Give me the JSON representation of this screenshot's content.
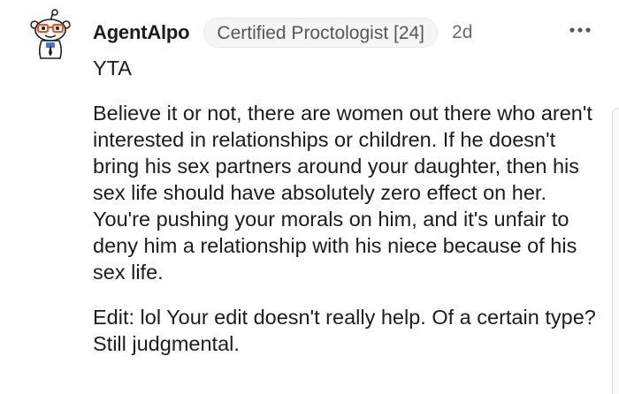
{
  "comment": {
    "author": "AgentAlpo",
    "flair": "Certified Proctologist [24]",
    "age": "2d",
    "verdict": "YTA",
    "paragraphs": [
      "Believe it or not, there are women out there who aren't interested in relationships or children. If he doesn't bring his sex partners around your daughter, then his sex life should have absolutely zero effect on her. You're pushing your morals on him, and it's unfair to deny him a relationship with his niece because of his sex life.",
      "Edit: lol Your edit doesn't really help. Of a certain type? Still judgmental."
    ],
    "avatar_icon": "snoo-avatar-icon",
    "menu_icon": "more-options-icon"
  },
  "colors": {
    "text": "#1c1c1c",
    "meta": "#6b6b6b",
    "flair_bg": "#f5f5f5",
    "avatar_glasses": "#e8572a"
  }
}
